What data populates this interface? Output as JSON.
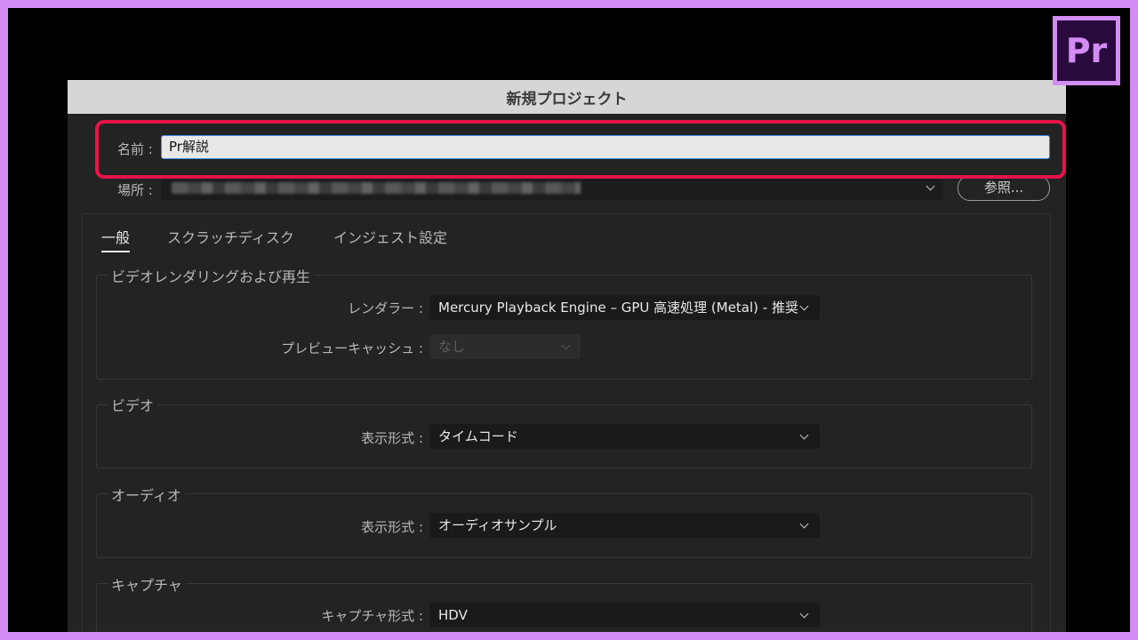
{
  "colors": {
    "accent_border": "#d38cf4",
    "highlight": "#e8134a",
    "dialog_bg": "#232323",
    "input_focus": "#3b8de8"
  },
  "logo": {
    "text": "Pr"
  },
  "dialog": {
    "title": "新規プロジェクト",
    "name_label": "名前 :",
    "name_value": "Pr解説",
    "location_label": "場所 :",
    "browse_label": "参照..."
  },
  "tabs": [
    {
      "label": "一般",
      "active": true
    },
    {
      "label": "スクラッチディスク",
      "active": false
    },
    {
      "label": "インジェスト設定",
      "active": false
    }
  ],
  "sections": {
    "playback": {
      "title": "ビデオレンダリングおよび再生",
      "renderer_label": "レンダラー :",
      "renderer_value": "Mercury Playback Engine – GPU 高速処理 (Metal) - 推奨",
      "preview_cache_label": "プレビューキャッシュ :",
      "preview_cache_value": "なし"
    },
    "video": {
      "title": "ビデオ",
      "display_format_label": "表示形式 :",
      "display_format_value": "タイムコード"
    },
    "audio": {
      "title": "オーディオ",
      "display_format_label": "表示形式 :",
      "display_format_value": "オーディオサンプル"
    },
    "capture": {
      "title": "キャプチャ",
      "capture_format_label": "キャプチャ形式 :",
      "capture_format_value": "HDV"
    }
  }
}
